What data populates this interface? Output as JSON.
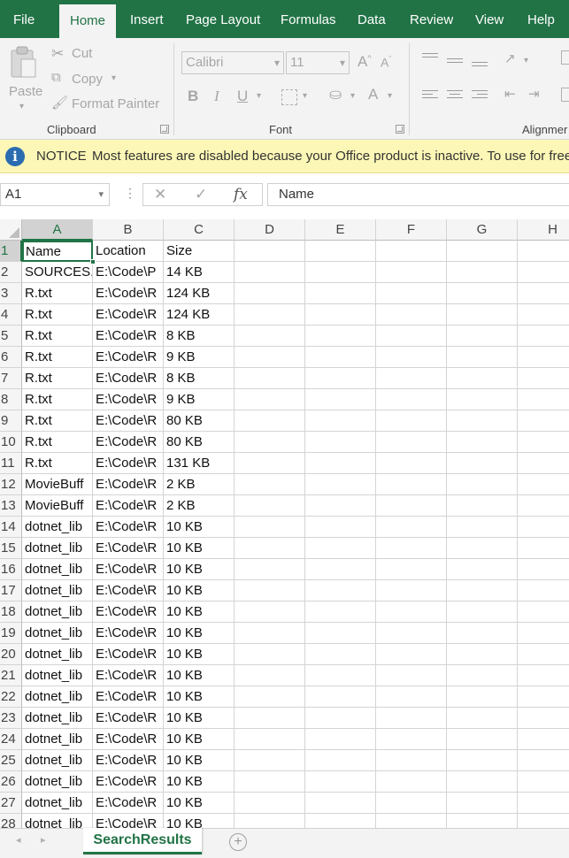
{
  "ribbon_tabs": [
    "File",
    "Home",
    "Insert",
    "Page Layout",
    "Formulas",
    "Data",
    "Review",
    "View",
    "Help"
  ],
  "active_tab": "Home",
  "clipboard": {
    "paste_label": "Paste",
    "cut_label": "Cut",
    "copy_label": "Copy",
    "format_painter_label": "Format Painter",
    "group_label": "Clipboard"
  },
  "font": {
    "font_name": "Calibri",
    "font_size": "11",
    "group_label": "Font"
  },
  "alignment": {
    "group_label": "Alignmer"
  },
  "notice": {
    "title": "NOTICE",
    "message": "Most features are disabled because your Office product is inactive. To use for free,"
  },
  "formula_bar": {
    "name_box": "A1",
    "content": "Name"
  },
  "columns": [
    "A",
    "B",
    "C",
    "D",
    "E",
    "F",
    "G",
    "H"
  ],
  "rows": [
    {
      "n": "1",
      "a": "Name",
      "b": "Location",
      "c": "Size"
    },
    {
      "n": "2",
      "a": "SOURCES.t",
      "b": "E:\\Code\\P",
      "c": "14 KB"
    },
    {
      "n": "3",
      "a": "R.txt",
      "b": "E:\\Code\\R",
      "c": "124 KB"
    },
    {
      "n": "4",
      "a": "R.txt",
      "b": "E:\\Code\\R",
      "c": "124 KB"
    },
    {
      "n": "5",
      "a": "R.txt",
      "b": "E:\\Code\\R",
      "c": "8 KB"
    },
    {
      "n": "6",
      "a": "R.txt",
      "b": "E:\\Code\\R",
      "c": "9 KB"
    },
    {
      "n": "7",
      "a": "R.txt",
      "b": "E:\\Code\\R",
      "c": "8 KB"
    },
    {
      "n": "8",
      "a": "R.txt",
      "b": "E:\\Code\\R",
      "c": "9 KB"
    },
    {
      "n": "9",
      "a": "R.txt",
      "b": "E:\\Code\\R",
      "c": "80 KB"
    },
    {
      "n": "10",
      "a": "R.txt",
      "b": "E:\\Code\\R",
      "c": "80 KB"
    },
    {
      "n": "11",
      "a": "R.txt",
      "b": "E:\\Code\\R",
      "c": "131 KB"
    },
    {
      "n": "12",
      "a": "MovieBuff",
      "b": "E:\\Code\\R",
      "c": "2 KB"
    },
    {
      "n": "13",
      "a": "MovieBuff",
      "b": "E:\\Code\\R",
      "c": "2 KB"
    },
    {
      "n": "14",
      "a": "dotnet_lib",
      "b": "E:\\Code\\R",
      "c": "10 KB"
    },
    {
      "n": "15",
      "a": "dotnet_lib",
      "b": "E:\\Code\\R",
      "c": "10 KB"
    },
    {
      "n": "16",
      "a": "dotnet_lib",
      "b": "E:\\Code\\R",
      "c": "10 KB"
    },
    {
      "n": "17",
      "a": "dotnet_lib",
      "b": "E:\\Code\\R",
      "c": "10 KB"
    },
    {
      "n": "18",
      "a": "dotnet_lib",
      "b": "E:\\Code\\R",
      "c": "10 KB"
    },
    {
      "n": "19",
      "a": "dotnet_lib",
      "b": "E:\\Code\\R",
      "c": "10 KB"
    },
    {
      "n": "20",
      "a": "dotnet_lib",
      "b": "E:\\Code\\R",
      "c": "10 KB"
    },
    {
      "n": "21",
      "a": "dotnet_lib",
      "b": "E:\\Code\\R",
      "c": "10 KB"
    },
    {
      "n": "22",
      "a": "dotnet_lib",
      "b": "E:\\Code\\R",
      "c": "10 KB"
    },
    {
      "n": "23",
      "a": "dotnet_lib",
      "b": "E:\\Code\\R",
      "c": "10 KB"
    },
    {
      "n": "24",
      "a": "dotnet_lib",
      "b": "E:\\Code\\R",
      "c": "10 KB"
    },
    {
      "n": "25",
      "a": "dotnet_lib",
      "b": "E:\\Code\\R",
      "c": "10 KB"
    },
    {
      "n": "26",
      "a": "dotnet_lib",
      "b": "E:\\Code\\R",
      "c": "10 KB"
    },
    {
      "n": "27",
      "a": "dotnet_lib",
      "b": "E:\\Code\\R",
      "c": "10 KB"
    },
    {
      "n": "28",
      "a": "dotnet_lib",
      "b": "E:\\Code\\R",
      "c": "10 KB"
    }
  ],
  "sheet_tab": "SearchResults",
  "colors": {
    "accent": "#217346",
    "notice_bg": "#fcf7b6"
  }
}
